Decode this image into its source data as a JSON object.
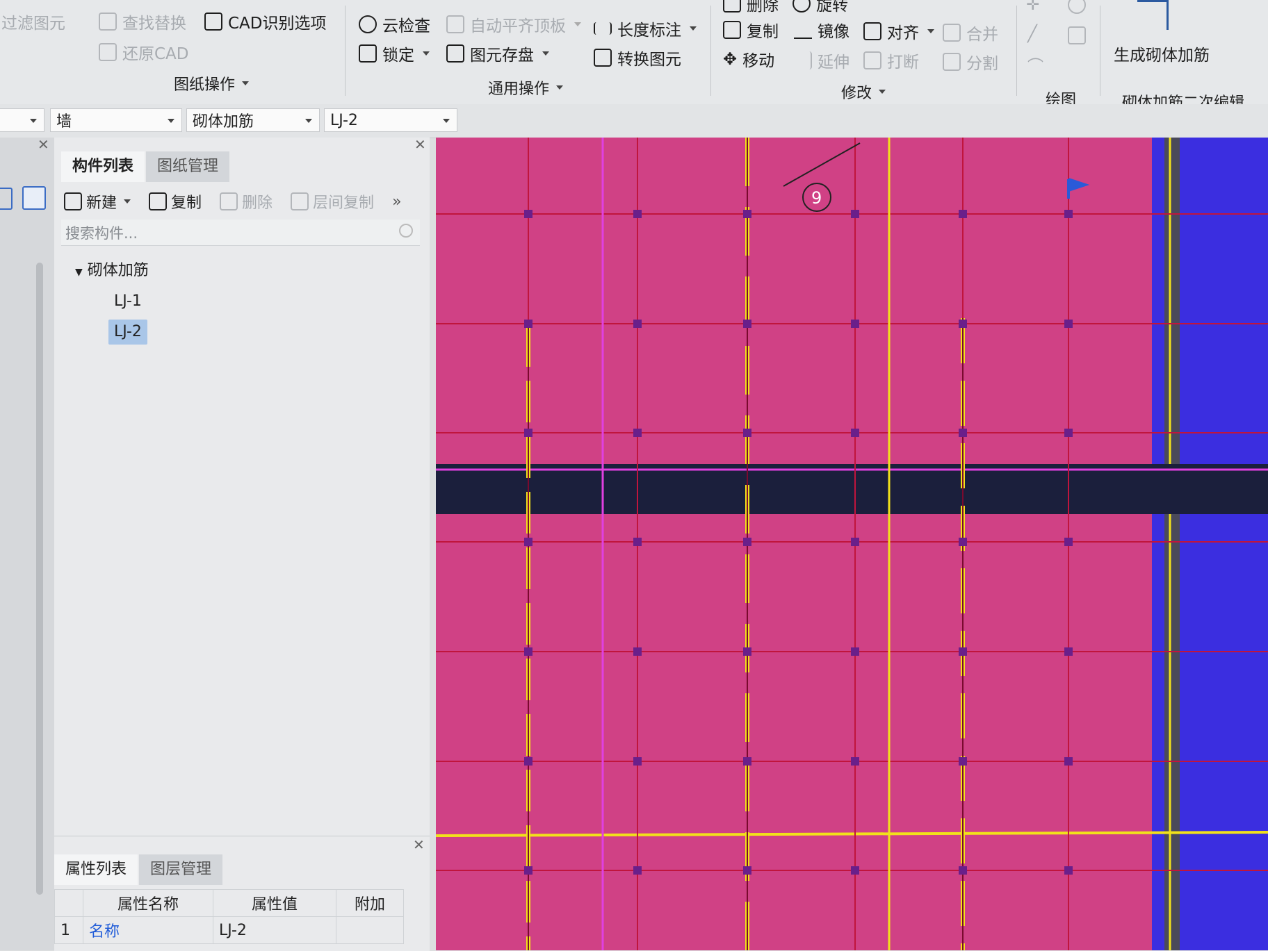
{
  "ribbon": {
    "filter_label": "过滤图元",
    "find_replace": "查找替换",
    "cad_options": "CAD识别选项",
    "restore_cad": "还原CAD",
    "group_drawing_ops": "图纸操作",
    "cloud_check": "云检查",
    "auto_align_top": "自动平齐顶板",
    "lock": "锁定",
    "element_save": "图元存盘",
    "length_dim": "长度标注",
    "convert_element": "转换图元",
    "group_common_ops": "通用操作",
    "delete": "删除",
    "rotate": "旋转",
    "copy": "复制",
    "mirror": "镜像",
    "align": "对齐",
    "merge": "合并",
    "move": "移动",
    "extend": "延伸",
    "break": "打断",
    "split": "分割",
    "group_modify": "修改",
    "group_draw": "绘图",
    "gen_masonry_rebar": "生成砌体加筋",
    "group_masonry_edit": "砌体加筋二次编辑"
  },
  "selectors": {
    "floor": "",
    "category": "墙",
    "type": "砌体加筋",
    "element": "LJ-2"
  },
  "component_panel": {
    "tabs": [
      "构件列表",
      "图纸管理"
    ],
    "tools": {
      "new": "新建",
      "copy": "复制",
      "delete": "删除",
      "floor_copy": "层间复制"
    },
    "search_placeholder": "搜索构件...",
    "tree": {
      "group": "砌体加筋",
      "items": [
        "LJ-1",
        "LJ-2"
      ],
      "selected": "LJ-2"
    }
  },
  "property_panel": {
    "tabs": [
      "属性列表",
      "图层管理"
    ],
    "headers": [
      "属性名称",
      "属性值",
      "附加"
    ],
    "rows": [
      {
        "index": "1",
        "name": "名称",
        "value": "LJ-2"
      }
    ]
  },
  "canvas": {
    "axis_label": "9",
    "colors": {
      "background": "#d04185",
      "grid": "#c0153d",
      "yellow": "#f2e21a",
      "wall": "#1b1f3c",
      "blue": "#3b2ee0"
    }
  }
}
